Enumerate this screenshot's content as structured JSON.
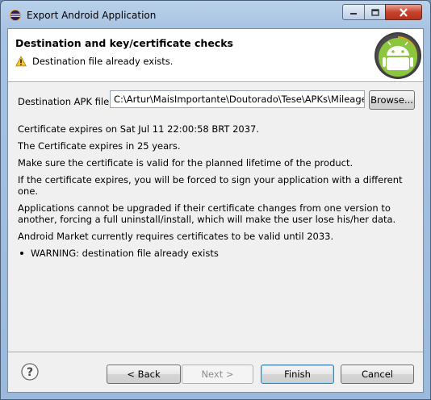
{
  "window": {
    "title": "Export Android Application",
    "controls": {
      "minimize": "minimize",
      "maximize": "maximize",
      "close": "close"
    }
  },
  "header": {
    "title": "Destination and key/certificate checks",
    "message": "Destination file already exists."
  },
  "apk": {
    "label": "Destination APK file:",
    "value": "C:\\Artur\\MaisImportante\\Doutorado\\Tese\\APKs\\MileageI",
    "browse_label": "Browse..."
  },
  "messages": [
    "Certificate expires on Sat Jul 11 22:00:58 BRT 2037.",
    "The Certificate expires in 25 years.",
    "Make sure the certificate is valid for the planned lifetime of the product.",
    "If the certificate expires, you will be forced to sign your application with a different one.",
    "Applications cannot be upgraded if their certificate changes from one version to another, forcing a full uninstall/install, which will make the user lose his/her data.",
    "Android Market currently requires certificates to be valid until 2033."
  ],
  "warnings": [
    "WARNING: destination file already exists"
  ],
  "footer": {
    "back": "< Back",
    "next": "Next >",
    "finish": "Finish",
    "cancel": "Cancel"
  },
  "icons": {
    "app": "eclipse-icon",
    "warning": "warning-icon",
    "logo": "android-logo",
    "help": "help-icon"
  }
}
